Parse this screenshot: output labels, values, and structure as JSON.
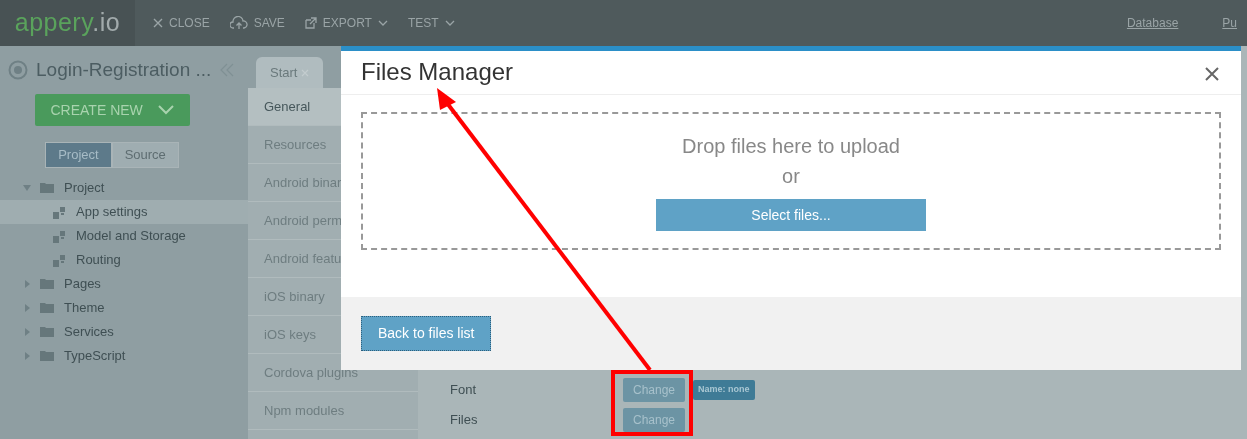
{
  "header": {
    "logo": {
      "brand": "appery",
      "domain": ".io"
    },
    "actions": [
      {
        "label": "CLOSE",
        "caret": false
      },
      {
        "label": "SAVE",
        "caret": false
      },
      {
        "label": "EXPORT",
        "caret": true
      },
      {
        "label": "TEST",
        "caret": true
      }
    ],
    "right_links": [
      "Database",
      "Pu"
    ]
  },
  "sidebar": {
    "project_title": "Login-Registration ...",
    "create_button": "CREATE NEW",
    "view_toggle": [
      {
        "label": "Project",
        "selected": true
      },
      {
        "label": "Source",
        "selected": false
      }
    ],
    "tree": [
      {
        "label": "Project",
        "kind": "folder",
        "expanded": true,
        "selected": false,
        "children": [
          {
            "label": "App settings",
            "kind": "file",
            "selected": true
          },
          {
            "label": "Model and Storage",
            "kind": "file",
            "selected": false
          },
          {
            "label": "Routing",
            "kind": "file",
            "selected": false
          }
        ]
      },
      {
        "label": "Pages",
        "kind": "folder",
        "expanded": false,
        "selected": false
      },
      {
        "label": "Theme",
        "kind": "folder",
        "expanded": false,
        "selected": false
      },
      {
        "label": "Services",
        "kind": "folder",
        "expanded": false,
        "selected": false
      },
      {
        "label": "TypeScript",
        "kind": "folder",
        "expanded": false,
        "selected": false
      }
    ]
  },
  "tabs": [
    {
      "label": "Start"
    }
  ],
  "settings_menu": [
    {
      "label": "General",
      "selected": true
    },
    {
      "label": "Resources",
      "selected": false
    },
    {
      "label": "Android binar",
      "selected": false
    },
    {
      "label": "Android perm",
      "selected": false
    },
    {
      "label": "Android featu",
      "selected": false
    },
    {
      "label": "iOS binary",
      "selected": false
    },
    {
      "label": "iOS keys",
      "selected": false
    },
    {
      "label": "Cordova plugins",
      "selected": false
    },
    {
      "label": "Npm modules",
      "selected": false
    }
  ],
  "resource_rows": [
    {
      "label": "Font",
      "button": "Change",
      "badge": "Name: none"
    },
    {
      "label": "Files",
      "button": "Change"
    }
  ],
  "modal": {
    "title": "Files Manager",
    "drop_text": "Drop files here to upload",
    "or_text": "or",
    "select_button": "Select files...",
    "back_button": "Back to files list"
  }
}
